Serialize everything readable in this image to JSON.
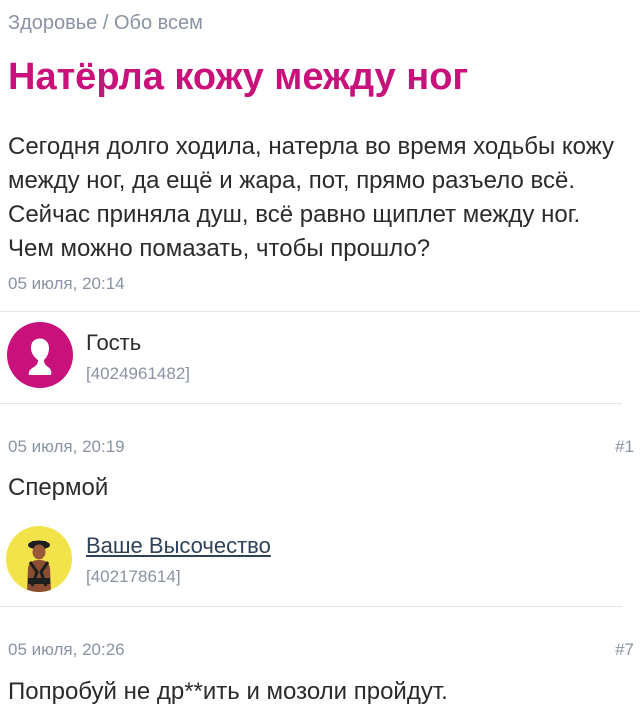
{
  "breadcrumb": {
    "section": "Здоровье",
    "separator": " / ",
    "subsection": "Обо всем"
  },
  "topic": {
    "title": "Натёрла кожу между ног",
    "body": "Сегодня долго ходила, натерла во время ходьбы кожу между ног, да ещё и жара, пот, прямо разъело всё. Сейчас приняла душ, всё равно щиплет между ног. Чем можно помазать, чтобы прошло?",
    "date": "05 июля, 20:14"
  },
  "posts": [
    {
      "author": "Гость",
      "author_id": "[4024961482]",
      "author_is_link": false,
      "date": "05 июля, 20:19",
      "number": "#1",
      "text": "Спермой"
    },
    {
      "author": "Ваше Высочество",
      "author_id": "[402178614]",
      "author_is_link": true,
      "date": "05 июля, 20:26",
      "number": "#7",
      "text": "Попробуй не др**ить и мозоли пройдут."
    }
  ],
  "colors": {
    "accent": "#c8117a",
    "meta_text": "#8a93a3",
    "body_text": "#2b2b2b",
    "divider": "#e3e6ea",
    "avatar_photo_bg": "#f2e34a"
  },
  "icons": {
    "guest_avatar": "person-silhouette-icon",
    "user_avatar": "user-photo-avatar"
  }
}
